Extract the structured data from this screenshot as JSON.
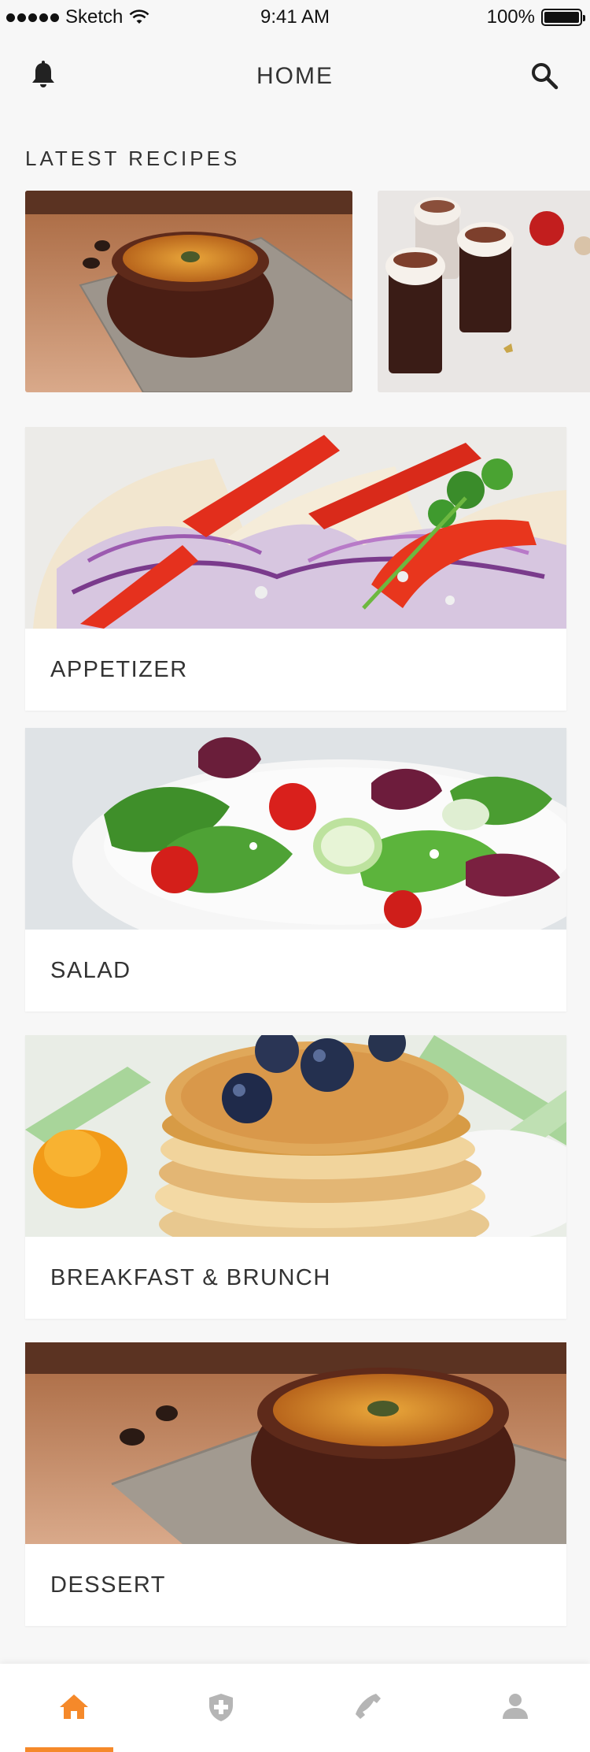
{
  "status_bar": {
    "carrier": "Sketch",
    "time": "9:41 AM",
    "battery": "100%",
    "battery_level": 1.0
  },
  "header": {
    "title": "HOME",
    "left_icon": "bell-icon",
    "right_icon": "search-icon"
  },
  "latest": {
    "title": "LATEST RECIPES",
    "items": [
      {
        "image": "soup-bowl-image"
      },
      {
        "image": "hot-chocolate-image"
      }
    ]
  },
  "categories": [
    {
      "label": "APPETIZER",
      "image": "tacos-image"
    },
    {
      "label": "SALAD",
      "image": "salad-image"
    },
    {
      "label": "BREAKFAST & BRUNCH",
      "image": "pancakes-image"
    },
    {
      "label": "DESSERT",
      "image": "soup-bowl-image"
    }
  ],
  "bottom_nav": {
    "items": [
      {
        "icon": "home-icon",
        "active": true
      },
      {
        "icon": "shield-plus-icon",
        "active": false
      },
      {
        "icon": "phone-icon",
        "active": false
      },
      {
        "icon": "user-icon",
        "active": false
      }
    ]
  },
  "colors": {
    "accent": "#f5892a",
    "inactive_icon": "#b5b5b5",
    "background": "#f7f7f7",
    "text": "#333333"
  }
}
